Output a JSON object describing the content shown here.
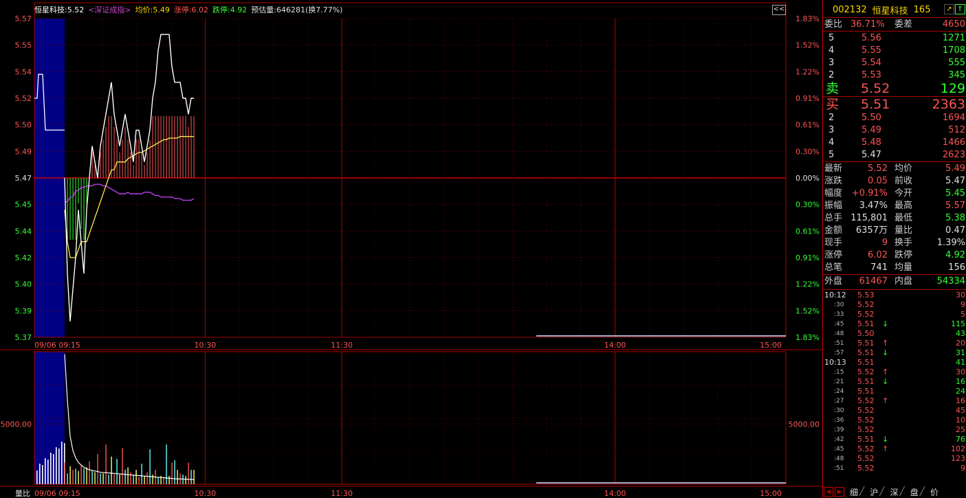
{
  "info_bar": {
    "stock": "恒星科技:5.52",
    "index_link": "<深证成指>",
    "avg": "均价:5.49",
    "limit_up": "涨停:6.02",
    "limit_down": "跌停:4.92",
    "estimate": "预估量:646281(换7.77%)"
  },
  "collapse_label": "<<",
  "chart_data": {
    "type": "line",
    "title": "",
    "prev_close": 5.47,
    "price_axis": {
      "left_labels": [
        "5.57",
        "5.55",
        "5.54",
        "5.52",
        "5.50",
        "5.49",
        "5.47",
        "5.45",
        "5.44",
        "5.42",
        "5.40",
        "5.39",
        "5.37"
      ],
      "right_labels": [
        "1.83%",
        "1.52%",
        "1.22%",
        "0.91%",
        "0.61%",
        "0.30%",
        "0.00%",
        "0.30%",
        "0.61%",
        "0.91%",
        "1.22%",
        "1.52%",
        "1.83%"
      ],
      "ylim": [
        5.37,
        5.57
      ]
    },
    "time_axis": {
      "labels": [
        "09/06 09:15",
        "10:30",
        "11:30",
        "14:00",
        "15:00"
      ]
    },
    "volume_axis": {
      "label": "5000.00",
      "left_caption": "量比"
    },
    "price_series": {
      "name": "",
      "x": [
        0,
        1,
        2,
        3,
        4,
        5,
        6,
        7,
        8,
        9,
        10,
        11,
        12,
        13,
        14,
        15,
        16,
        17,
        18,
        19,
        20,
        21,
        22,
        23,
        24,
        25,
        26,
        27,
        28,
        29,
        30,
        31,
        32,
        33,
        34,
        35,
        36,
        37,
        38,
        39,
        40,
        41,
        42,
        43,
        44,
        45,
        46,
        47
      ],
      "values": [
        5.47,
        5.41,
        5.38,
        5.4,
        5.42,
        5.45,
        5.43,
        5.41,
        5.45,
        5.47,
        5.49,
        5.48,
        5.47,
        5.49,
        5.5,
        5.51,
        5.52,
        5.53,
        5.51,
        5.5,
        5.49,
        5.5,
        5.51,
        5.5,
        5.49,
        5.48,
        5.5,
        5.5,
        5.49,
        5.48,
        5.49,
        5.5,
        5.52,
        5.53,
        5.55,
        5.56,
        5.56,
        5.56,
        5.56,
        5.54,
        5.53,
        5.53,
        5.53,
        5.52,
        5.52,
        5.51,
        5.52,
        5.52
      ]
    },
    "avg_series": {
      "name": "",
      "values": [
        5.45,
        5.43,
        5.42,
        5.42,
        5.42,
        5.425,
        5.43,
        5.43,
        5.43,
        5.435,
        5.44,
        5.445,
        5.45,
        5.455,
        5.46,
        5.465,
        5.47,
        5.475,
        5.475,
        5.48,
        5.48,
        5.48,
        5.48,
        5.482,
        5.483,
        5.484,
        5.485,
        5.486,
        5.486,
        5.487,
        5.488,
        5.489,
        5.49,
        5.491,
        5.492,
        5.493,
        5.494,
        5.494,
        5.495,
        5.495,
        5.495,
        5.495,
        5.496,
        5.496,
        5.496,
        5.496,
        5.496,
        5.496
      ]
    },
    "index_series": {
      "name": "",
      "values": [
        5.455,
        5.455,
        5.458,
        5.458,
        5.462,
        5.462,
        5.464,
        5.464,
        5.465,
        5.465,
        5.465,
        5.466,
        5.466,
        5.466,
        5.465,
        5.465,
        5.464,
        5.463,
        5.462,
        5.461,
        5.46,
        5.46,
        5.46,
        5.461,
        5.46,
        5.46,
        5.46,
        5.46,
        5.46,
        5.461,
        5.461,
        5.461,
        5.46,
        5.459,
        5.459,
        5.458,
        5.458,
        5.458,
        5.458,
        5.458,
        5.457,
        5.457,
        5.457,
        5.456,
        5.456,
        5.456,
        5.456,
        5.457
      ]
    },
    "volumes": [
      1800,
      900,
      1500,
      1200,
      1300,
      1100,
      1600,
      1300,
      1400,
      1900,
      1100,
      1000,
      2500,
      900,
      900,
      3300,
      800,
      2300,
      900,
      2100,
      800,
      3000,
      1200,
      1400,
      1000,
      800,
      1200,
      600,
      1700,
      700,
      1000,
      2900,
      800,
      1200,
      600,
      700,
      600,
      3300,
      700,
      1800,
      2000,
      1200,
      900,
      800,
      700,
      1800,
      1200,
      1200
    ],
    "volume_ylim": [
      0,
      11000
    ]
  },
  "panel": {
    "code": "002132",
    "name": "恒星科技",
    "num": "165",
    "weibi_label": "委比",
    "weibi": "36.71%",
    "weicha_label": "委差",
    "weicha": "4650",
    "asks": [
      {
        "level": "5",
        "price": "5.56",
        "vol": "1271"
      },
      {
        "level": "4",
        "price": "5.55",
        "vol": "1708"
      },
      {
        "level": "3",
        "price": "5.54",
        "vol": "555"
      },
      {
        "level": "2",
        "price": "5.53",
        "vol": "345"
      }
    ],
    "ask1": {
      "level": "卖",
      "price": "5.52",
      "vol": "129"
    },
    "bid1": {
      "level": "买",
      "price": "5.51",
      "vol": "2363"
    },
    "bids": [
      {
        "level": "2",
        "price": "5.50",
        "vol": "1694"
      },
      {
        "level": "3",
        "price": "5.49",
        "vol": "512"
      },
      {
        "level": "4",
        "price": "5.48",
        "vol": "1466"
      },
      {
        "level": "5",
        "price": "5.47",
        "vol": "2623"
      }
    ],
    "stats": [
      {
        "l1": "最新",
        "v1": "5.52",
        "c1": "red",
        "l2": "均价",
        "v2": "5.49",
        "c2": "red"
      },
      {
        "l1": "涨跌",
        "v1": "0.05",
        "c1": "red",
        "l2": "前收",
        "v2": "5.47",
        "c2": "white"
      },
      {
        "l1": "幅度",
        "v1": "+0.91%",
        "c1": "red",
        "l2": "今开",
        "v2": "5.45",
        "c2": "green"
      },
      {
        "l1": "振幅",
        "v1": "3.47%",
        "c1": "white",
        "l2": "最高",
        "v2": "5.57",
        "c2": "red"
      },
      {
        "l1": "总手",
        "v1": "115,801",
        "c1": "white",
        "l2": "最低",
        "v2": "5.38",
        "c2": "green"
      },
      {
        "l1": "金额",
        "v1": "6357万",
        "c1": "white",
        "l2": "量比",
        "v2": "0.47",
        "c2": "white"
      },
      {
        "l1": "现手",
        "v1": "9",
        "c1": "red",
        "l2": "换手",
        "v2": "1.39%",
        "c2": "white"
      },
      {
        "l1": "涨停",
        "v1": "6.02",
        "c1": "red",
        "l2": "跌停",
        "v2": "4.92",
        "c2": "green"
      },
      {
        "l1": "总笔",
        "v1": "741",
        "c1": "white",
        "l2": "均量",
        "v2": "156",
        "c2": "white"
      }
    ],
    "waipan_label": "外盘",
    "waipan": "61467",
    "neipan_label": "内盘",
    "neipan": "54334",
    "ticks": [
      {
        "t": "10:12",
        "p": "5.53",
        "a": "",
        "v": "30",
        "vc": "red"
      },
      {
        "t": ":30",
        "p": "5.52",
        "a": "",
        "v": "9",
        "vc": "red"
      },
      {
        "t": ":33",
        "p": "5.52",
        "a": "",
        "v": "5",
        "vc": "red"
      },
      {
        "t": ":45",
        "p": "5.51",
        "a": "↓",
        "v": "115",
        "vc": "green"
      },
      {
        "t": ":48",
        "p": "5.50",
        "a": "",
        "v": "43",
        "vc": "green"
      },
      {
        "t": ":51",
        "p": "5.51",
        "a": "↑",
        "v": "20",
        "vc": "red"
      },
      {
        "t": ":57",
        "p": "5.51",
        "a": "↓",
        "v": "31",
        "vc": "green"
      },
      {
        "t": "10:13",
        "p": "5.51",
        "a": "",
        "v": "41",
        "vc": "green"
      },
      {
        "t": ":15",
        "p": "5.52",
        "a": "↑",
        "v": "30",
        "vc": "red"
      },
      {
        "t": ":21",
        "p": "5.51",
        "a": "↓",
        "v": "16",
        "vc": "green"
      },
      {
        "t": ":24",
        "p": "5.51",
        "a": "",
        "v": "24",
        "vc": "green"
      },
      {
        "t": ":27",
        "p": "5.52",
        "a": "↑",
        "v": "16",
        "vc": "red"
      },
      {
        "t": ":30",
        "p": "5.52",
        "a": "",
        "v": "45",
        "vc": "red"
      },
      {
        "t": ":36",
        "p": "5.52",
        "a": "",
        "v": "10",
        "vc": "red"
      },
      {
        "t": ":39",
        "p": "5.52",
        "a": "",
        "v": "25",
        "vc": "red"
      },
      {
        "t": ":42",
        "p": "5.51",
        "a": "↓",
        "v": "76",
        "vc": "green"
      },
      {
        "t": ":45",
        "p": "5.52",
        "a": "↑",
        "v": "102",
        "vc": "red"
      },
      {
        "t": ":48",
        "p": "5.52",
        "a": "",
        "v": "123",
        "vc": "red"
      },
      {
        "t": ":51",
        "p": "5.52",
        "a": "",
        "v": "9",
        "vc": "red"
      }
    ],
    "tabs": [
      "细",
      "沪",
      "深",
      "盘",
      "价"
    ]
  }
}
